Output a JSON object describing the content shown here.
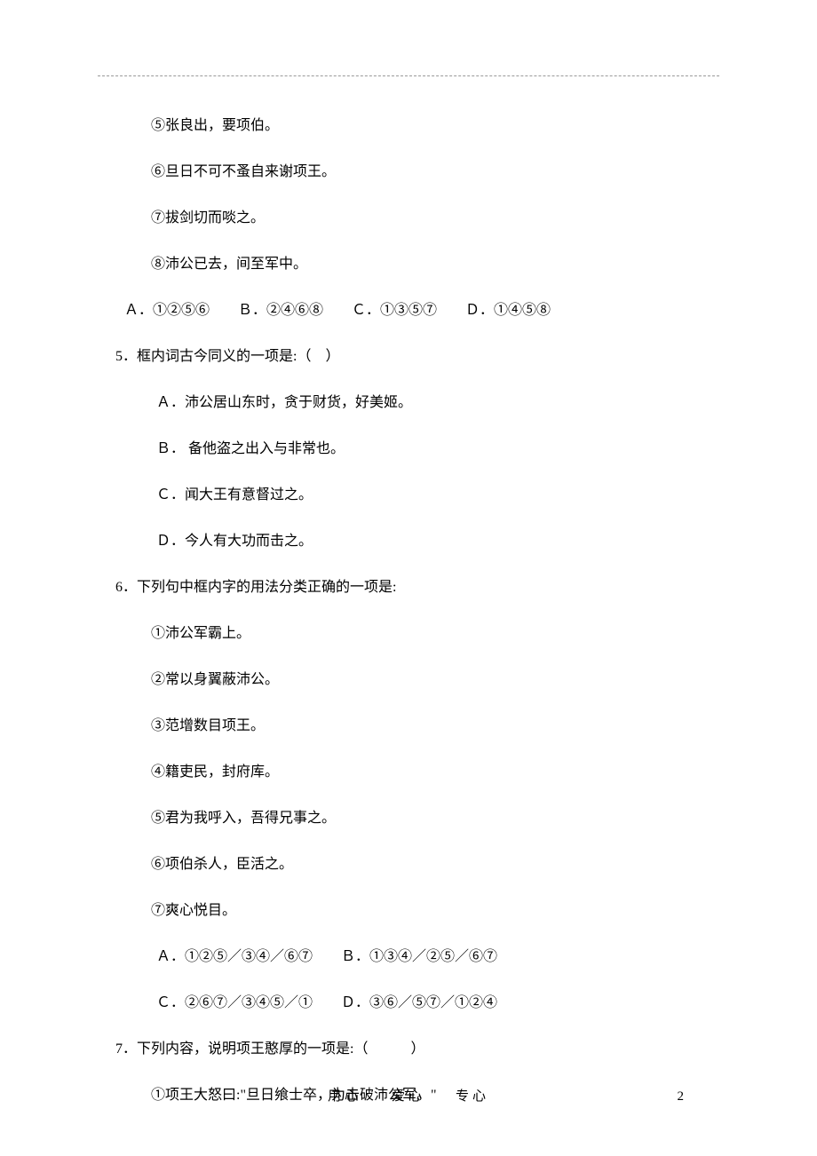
{
  "q4_items": {
    "i5": "⑤张良出，要项伯。",
    "i6": "⑥旦日不可不蚤自来谢项王。",
    "i7": "⑦拔剑切而啖之。",
    "i8": "⑧沛公已去，间至军中。"
  },
  "q4_options": "Ａ．①②⑤⑥　　Ｂ．②④⑥⑧　　Ｃ．①③⑤⑦　　Ｄ．①④⑤⑧",
  "q5": {
    "stem": "5．框内词古今同义的一项是:（　）",
    "a": "Ａ．沛公居山东时，贪于财货，好美姬。",
    "b": "Ｂ． 备他盗之出入与非常也。",
    "c": "Ｃ．闻大王有意督过之。",
    "d": "Ｄ．今人有大功而击之。"
  },
  "q6": {
    "stem": "6．下列句中框内字的用法分类正确的一项是:",
    "i1": "①沛公军霸上。",
    "i2": "②常以身翼蔽沛公。",
    "i3": "③范增数目项王。",
    "i4": "④籍吏民，封府库。",
    "i5": "⑤君为我呼入，吾得兄事之。",
    "i6": "⑥项伯杀人，臣活之。",
    "i7": "⑦爽心悦目。",
    "opt1": "Ａ．①②⑤／③④／⑥⑦　　Ｂ．①③④／②⑤／⑥⑦",
    "opt2": "Ｃ．②⑥⑦／③④⑤／①　　Ｄ．③⑥／⑤⑦／①②④"
  },
  "q7": {
    "stem": "7．下列内容，说明项王憨厚的一项是:（　　　）",
    "i1": "①项王大怒曰:\"旦日飨士卒，为击破沛公军。\""
  },
  "footer": {
    "a": "用心",
    "b": "爱心",
    "c": "专心"
  },
  "page_number": "2"
}
